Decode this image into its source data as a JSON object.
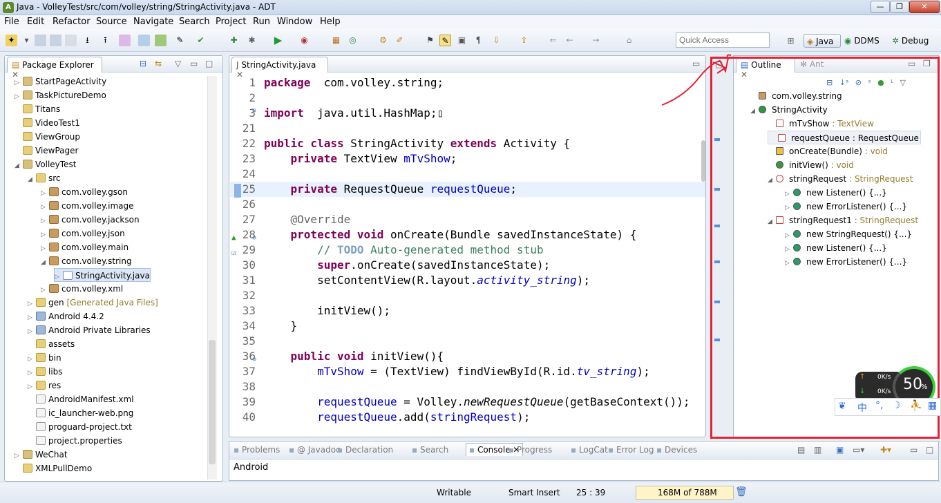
{
  "window": {
    "title": "Java - VolleyTest/src/com/volley/string/StringActivity.java - ADT",
    "minimize": "—",
    "maximize": "❐",
    "close": "✕"
  },
  "menu": [
    "File",
    "Edit",
    "Refactor",
    "Source",
    "Navigate",
    "Search",
    "Project",
    "Run",
    "Window",
    "Help"
  ],
  "quick_access": {
    "placeholder": "Quick Access"
  },
  "perspectives": [
    "Java",
    "DDMS",
    "Debug"
  ],
  "package_explorer": {
    "title": "Package Explorer",
    "items": [
      {
        "label": "StartPageActivity",
        "type": "project",
        "depth": 0,
        "tw": "▷"
      },
      {
        "label": "TaskPictureDemo",
        "type": "project",
        "depth": 0,
        "tw": "▷"
      },
      {
        "label": "Titans",
        "type": "folder",
        "depth": 0,
        "tw": ""
      },
      {
        "label": "VideoTest1",
        "type": "folder",
        "depth": 0,
        "tw": ""
      },
      {
        "label": "ViewGroup",
        "type": "folder",
        "depth": 0,
        "tw": ""
      },
      {
        "label": "ViewPager",
        "type": "folder",
        "depth": 0,
        "tw": ""
      },
      {
        "label": "VolleyTest",
        "type": "project",
        "depth": 0,
        "tw": "◢"
      },
      {
        "label": "src",
        "type": "folder",
        "depth": 1,
        "tw": "◢"
      },
      {
        "label": "com.volley.gson",
        "type": "pkg",
        "depth": 2,
        "tw": "▷"
      },
      {
        "label": "com.volley.image",
        "type": "pkg",
        "depth": 2,
        "tw": "▷"
      },
      {
        "label": "com.volley.jackson",
        "type": "pkg",
        "depth": 2,
        "tw": "▷"
      },
      {
        "label": "com.volley.json",
        "type": "pkg",
        "depth": 2,
        "tw": "▷"
      },
      {
        "label": "com.volley.main",
        "type": "pkg",
        "depth": 2,
        "tw": "▷"
      },
      {
        "label": "com.volley.string",
        "type": "pkg",
        "depth": 2,
        "tw": "◢"
      },
      {
        "label": "StringActivity.java",
        "type": "java",
        "depth": 3,
        "tw": "▷"
      },
      {
        "label": "com.volley.xml",
        "type": "pkg",
        "depth": 2,
        "tw": "▷"
      },
      {
        "label": "gen",
        "suffix": "[Generated Java Files]",
        "type": "folder",
        "depth": 1,
        "tw": "▷"
      },
      {
        "label": "Android 4.4.2",
        "type": "lib",
        "depth": 1,
        "tw": "▷"
      },
      {
        "label": "Android Private Libraries",
        "type": "lib",
        "depth": 1,
        "tw": "▷"
      },
      {
        "label": "assets",
        "type": "folder",
        "depth": 1,
        "tw": ""
      },
      {
        "label": "bin",
        "type": "folder",
        "depth": 1,
        "tw": "▷"
      },
      {
        "label": "libs",
        "type": "folder",
        "depth": 1,
        "tw": "▷"
      },
      {
        "label": "res",
        "type": "folder",
        "depth": 1,
        "tw": "▷"
      },
      {
        "label": "AndroidManifest.xml",
        "type": "file",
        "depth": 1,
        "tw": ""
      },
      {
        "label": "ic_launcher-web.png",
        "type": "file",
        "depth": 1,
        "tw": ""
      },
      {
        "label": "proguard-project.txt",
        "type": "file",
        "depth": 1,
        "tw": ""
      },
      {
        "label": "project.properties",
        "type": "file",
        "depth": 1,
        "tw": ""
      },
      {
        "label": "WeChat",
        "type": "project",
        "depth": 0,
        "tw": "▷"
      },
      {
        "label": "XMLPullDemo",
        "type": "folder",
        "depth": 0,
        "tw": ""
      }
    ]
  },
  "editor": {
    "tab": "StringActivity.java",
    "lines": [
      {
        "n": "1",
        "segs": [
          [
            "kw",
            "package"
          ],
          [
            "",
            "  com.volley.string;"
          ]
        ]
      },
      {
        "n": "2",
        "segs": []
      },
      {
        "n": "3",
        "segs": [
          [
            "kw",
            "import"
          ],
          [
            "",
            "  java.util.HashMap;▯"
          ]
        ]
      },
      {
        "n": "21",
        "segs": []
      },
      {
        "n": "22",
        "segs": [
          [
            "kw",
            "public class"
          ],
          [
            "",
            " StringActivity "
          ],
          [
            "kw",
            "extends"
          ],
          [
            "",
            " Activity {"
          ]
        ]
      },
      {
        "n": "23",
        "segs": [
          [
            "",
            "    "
          ],
          [
            "kw",
            "private"
          ],
          [
            "",
            " TextView "
          ],
          [
            "fld",
            "mTvShow"
          ],
          [
            "",
            ";"
          ]
        ]
      },
      {
        "n": "24",
        "segs": []
      },
      {
        "n": "25",
        "segs": [
          [
            "",
            "    "
          ],
          [
            "kw",
            "private"
          ],
          [
            "",
            " RequestQueue "
          ],
          [
            "fld",
            "requestQueue"
          ],
          [
            "",
            ";"
          ]
        ]
      },
      {
        "n": "26",
        "segs": []
      },
      {
        "n": "27",
        "segs": [
          [
            "ann",
            "    @Override"
          ]
        ]
      },
      {
        "n": "28",
        "segs": [
          [
            "",
            "    "
          ],
          [
            "kw",
            "protected void"
          ],
          [
            "",
            " onCreate(Bundle savedInstanceState) {"
          ]
        ]
      },
      {
        "n": "29",
        "segs": [
          [
            "com",
            "        // "
          ],
          [
            "todo",
            "TODO"
          ],
          [
            "com",
            " Auto-generated method stub"
          ]
        ]
      },
      {
        "n": "30",
        "segs": [
          [
            "",
            "        "
          ],
          [
            "kw",
            "super"
          ],
          [
            "",
            ".onCreate(savedInstanceState);"
          ]
        ]
      },
      {
        "n": "31",
        "segs": [
          [
            "",
            "        setContentView(R.layout."
          ],
          [
            "fld ital",
            "activity_string"
          ],
          [
            "",
            ");"
          ]
        ]
      },
      {
        "n": "32",
        "segs": []
      },
      {
        "n": "33",
        "segs": [
          [
            "",
            "        initView();"
          ]
        ]
      },
      {
        "n": "34",
        "segs": [
          [
            "",
            "    }"
          ]
        ]
      },
      {
        "n": "35",
        "segs": []
      },
      {
        "n": "36",
        "segs": [
          [
            "",
            "    "
          ],
          [
            "kw",
            "public void"
          ],
          [
            "",
            " initView(){"
          ]
        ]
      },
      {
        "n": "37",
        "segs": [
          [
            "",
            "        "
          ],
          [
            "fld",
            "mTvShow"
          ],
          [
            "",
            " = (TextView) findViewById(R.id."
          ],
          [
            "fld ital",
            "tv_string"
          ],
          [
            "",
            ");"
          ]
        ]
      },
      {
        "n": "38",
        "segs": []
      },
      {
        "n": "39",
        "segs": [
          [
            "",
            "        "
          ],
          [
            "fld",
            "requestQueue"
          ],
          [
            "",
            " = Volley."
          ],
          [
            "ital",
            "newRequestQueue"
          ],
          [
            "",
            "(getBaseContext());"
          ]
        ]
      },
      {
        "n": "40",
        "segs": [
          [
            "",
            "        "
          ],
          [
            "fld",
            "requestQueue"
          ],
          [
            "",
            ".add("
          ],
          [
            "fld",
            "stringRequest"
          ],
          [
            "",
            ");"
          ]
        ]
      }
    ]
  },
  "outline": {
    "tab": "Outline",
    "tab2": "Ant",
    "items": [
      {
        "label": "com.volley.string",
        "type": "",
        "icon": "pkg",
        "indent": 0,
        "tw": ""
      },
      {
        "label": "StringActivity",
        "type": "",
        "icon": "class",
        "indent": 0,
        "tw": "◢"
      },
      {
        "label": "mTvShow",
        "type": " : TextView",
        "icon": "pfield",
        "indent": 1,
        "tw": ""
      },
      {
        "label": "requestQueue",
        "type": " : RequestQueue",
        "icon": "pfield",
        "indent": 1,
        "tw": "",
        "selected": true
      },
      {
        "label": "onCreate(Bundle)",
        "type": " : void",
        "icon": "prot",
        "indent": 1,
        "tw": ""
      },
      {
        "label": "initView()",
        "type": " : void",
        "icon": "pub",
        "indent": 1,
        "tw": ""
      },
      {
        "label": "stringRequest",
        "type": " : StringRequest",
        "icon": "pubfield",
        "indent": 1,
        "tw": "◢"
      },
      {
        "label": "new Listener() {...}",
        "type": "",
        "icon": "anon",
        "indent": 2,
        "tw": "▷"
      },
      {
        "label": "new ErrorListener() {...}",
        "type": "",
        "icon": "anon",
        "indent": 2,
        "tw": "▷"
      },
      {
        "label": "stringRequest1",
        "type": " : StringRequest",
        "icon": "deffield",
        "indent": 1,
        "tw": "◢"
      },
      {
        "label": "new StringRequest() {...}",
        "type": "",
        "icon": "anon",
        "indent": 2,
        "tw": "▷"
      },
      {
        "label": "new Listener() {...}",
        "type": "",
        "icon": "anon",
        "indent": 2,
        "tw": "▷"
      },
      {
        "label": "new ErrorListener() {...}",
        "type": "",
        "icon": "anon",
        "indent": 2,
        "tw": "▷"
      }
    ]
  },
  "bottom": {
    "tabs": [
      "Problems",
      "@ Javadoc",
      "Declaration",
      "Search",
      "Console",
      "Progress",
      "LogCat",
      "Error Log",
      "Devices"
    ],
    "active": "Console",
    "console_text": "Android"
  },
  "status": {
    "writable": "Writable",
    "insert": "Smart Insert",
    "pos": "25 : 39",
    "memory": "168M of 788M"
  },
  "net_widget": {
    "up": "0K/s",
    "down": "0K/s",
    "percent": "50",
    "pct_sign": "%"
  },
  "ime": [
    "中",
    "°,",
    "☽"
  ],
  "colors": {
    "highlight": "#e52235",
    "accent": "#3a6ec2"
  }
}
